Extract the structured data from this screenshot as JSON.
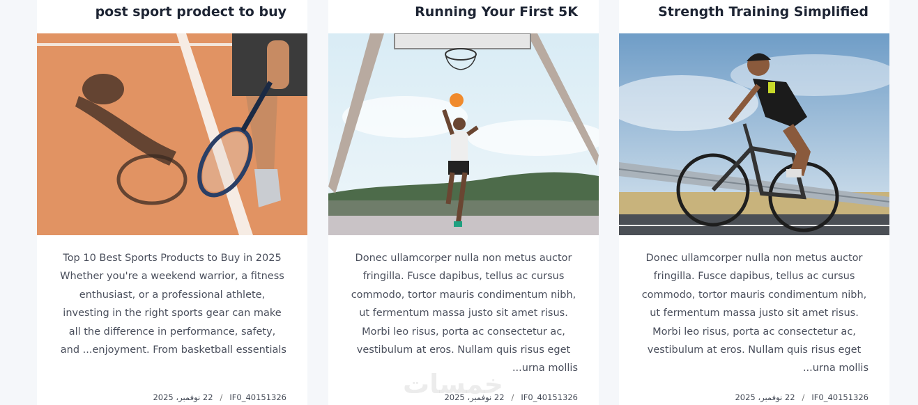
{
  "cards": [
    {
      "title": "post sport prodect to buy",
      "excerpt": "Top 10 Best Sports Products to Buy in 2025 Whether you're a weekend warrior, a fitness enthusiast, or a professional athlete, investing in the right sports gear can make all the difference in performance, safety, and ...enjoyment. From basketball essentials",
      "date": "22 نوفمبر، 2025",
      "separator": "/",
      "author": "IF0_40151326",
      "image": "tennis-player-photo"
    },
    {
      "title": "Running Your First 5K",
      "excerpt": "Donec ullamcorper nulla non metus auctor fringilla. Fusce dapibus, tellus ac cursus commodo, tortor mauris condimentum nibh, ut fermentum massa justo sit amet risus. Morbi leo risus, porta ac consectetur ac, vestibulum at eros. Nullam quis risus eget ...urna mollis",
      "date": "22 نوفمبر، 2025",
      "separator": "/",
      "author": "IF0_40151326",
      "image": "basketball-player-photo"
    },
    {
      "title": "Strength Training Simplified",
      "excerpt": "Donec ullamcorper nulla non metus auctor fringilla. Fusce dapibus, tellus ac cursus commodo, tortor mauris condimentum nibh, ut fermentum massa justo sit amet risus. Morbi leo risus, porta ac consectetur ac, vestibulum at eros. Nullam quis risus eget ...urna mollis",
      "date": "22 نوفمبر، 2025",
      "separator": "/",
      "author": "IF0_40151326",
      "image": "cyclist-photo"
    }
  ],
  "watermark": "خمسات"
}
